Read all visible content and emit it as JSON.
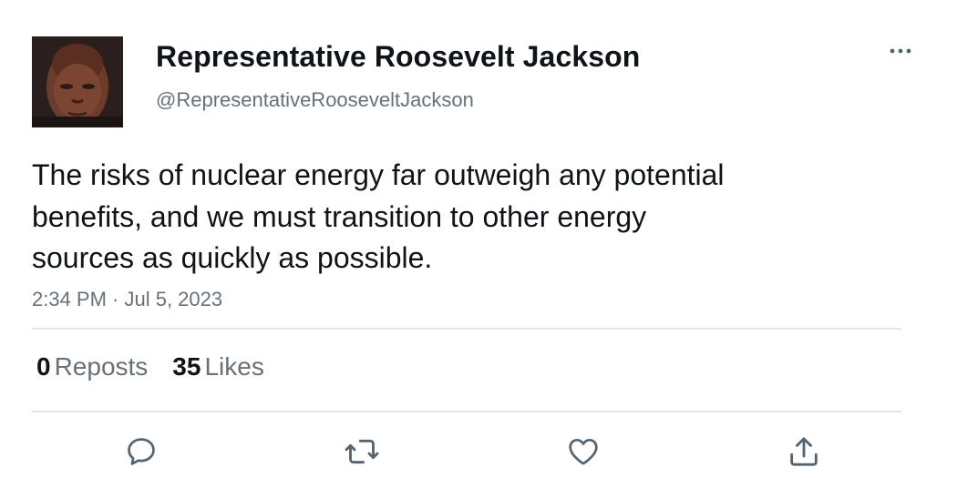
{
  "author": {
    "display_name": "Representative Roosevelt Jackson",
    "handle": "@RepresentativeRooseveltJackson",
    "avatar_icon": "profile-photo"
  },
  "tweet": {
    "text_lines": [
      "The risks of nuclear energy far outweigh any potential",
      "benefits, and we must transition to other energy",
      "sources as quickly as possible."
    ],
    "timestamp": "2:34 PM · Jul 5, 2023"
  },
  "stats": {
    "reposts_count": "0",
    "reposts_label": "Reposts",
    "likes_count": "35",
    "likes_label": "Likes"
  },
  "actions": [
    {
      "icon": "reply-icon"
    },
    {
      "icon": "repost-icon"
    },
    {
      "icon": "like-icon"
    },
    {
      "icon": "share-icon"
    }
  ],
  "colors": {
    "text": "#0f1419",
    "secondary": "#66717b",
    "divider": "#e3e6e8",
    "icon": "#536471"
  }
}
